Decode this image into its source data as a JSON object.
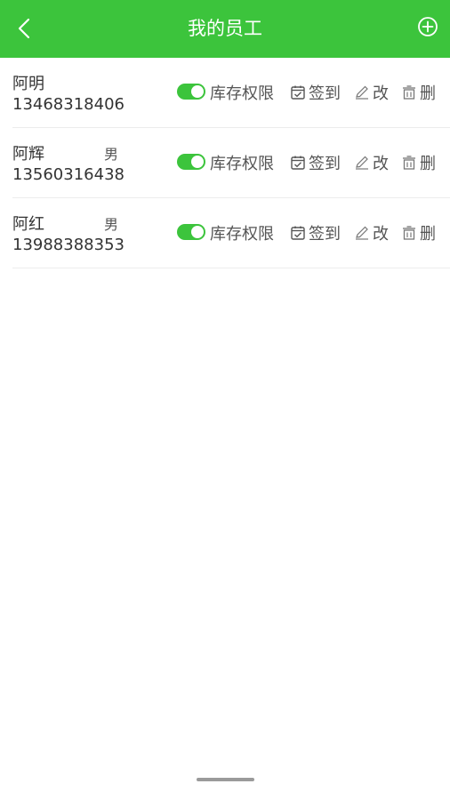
{
  "header": {
    "title": "我的员工",
    "color": "#3cc43c",
    "back_icon": "chevron-left-icon",
    "add_icon": "plus-circle-icon"
  },
  "actions": {
    "permission_label": "库存权限",
    "signin_label": "签到",
    "edit_label": "改",
    "delete_label": "删",
    "signin_icon": "calendar-check-icon",
    "edit_icon": "pencil-icon",
    "delete_icon": "trash-icon"
  },
  "employees": [
    {
      "name": "阿明",
      "gender": "",
      "phone": "13468318406",
      "permission_enabled": true
    },
    {
      "name": "阿辉",
      "gender": "男",
      "phone": "13560316438",
      "permission_enabled": true
    },
    {
      "name": "阿红",
      "gender": "男",
      "phone": "13988388353",
      "permission_enabled": true
    }
  ]
}
